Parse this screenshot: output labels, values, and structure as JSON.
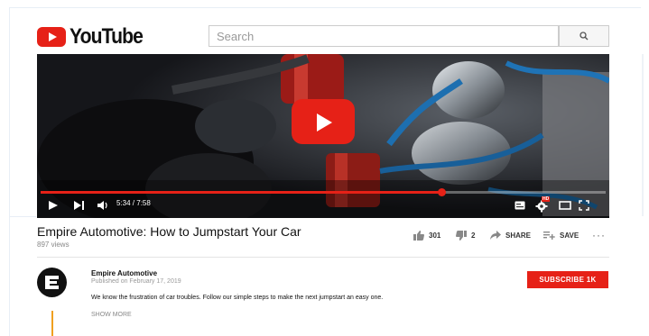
{
  "brand": {
    "logo_text": "YouTube",
    "accent": "#e62117"
  },
  "search": {
    "placeholder": "Search"
  },
  "player": {
    "current_time": "5:34",
    "separator": " / ",
    "duration": "7:58",
    "progress_fraction": 0.71,
    "hd_badge": "HD"
  },
  "video": {
    "title": "Empire Automotive: How to Jumpstart Your Car",
    "views": "897 views"
  },
  "actions": {
    "likes": "301",
    "dislikes": "2",
    "share": "SHARE",
    "save": "SAVE",
    "more": "···"
  },
  "channel": {
    "name": "Empire Automotive",
    "published": "Published on February 17, 2019",
    "description": "We know the frustration of car troubles. Follow our simple steps to make the next jumpstart an easy one.",
    "show_more": "SHOW MORE",
    "subscribe": "SUBSCRIBE 1K"
  }
}
